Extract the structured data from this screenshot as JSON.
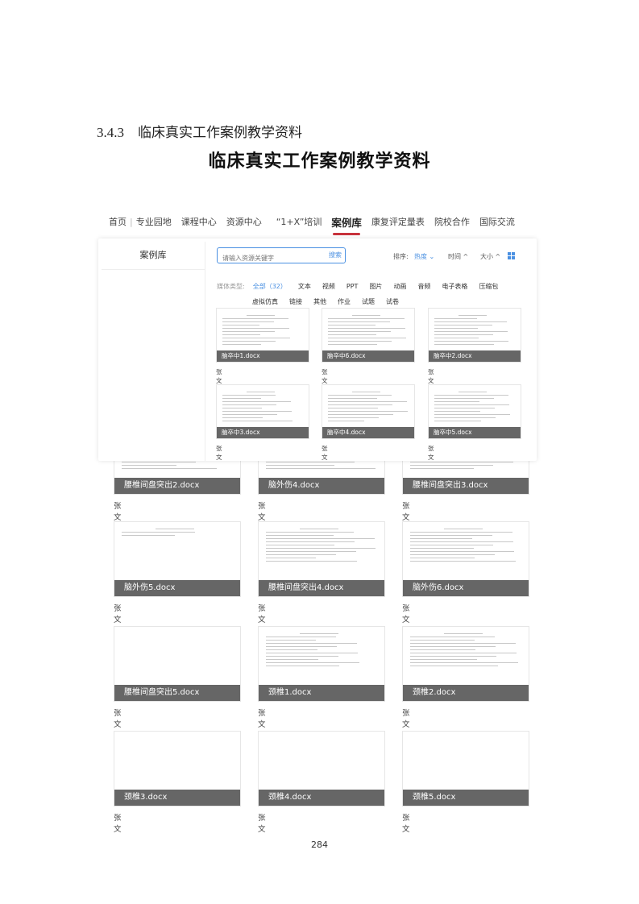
{
  "section": {
    "number": "3.4.3",
    "title": "临床真实工作案例教学资料"
  },
  "main_title": "临床真实工作案例教学资料",
  "nav": {
    "items": [
      "首页",
      "专业园地",
      "课程中心",
      "资源中心",
      "“1+X”培训",
      "案例库",
      "康复评定量表",
      "院校合作",
      "国际交流"
    ],
    "active": "案例库"
  },
  "sidebar": {
    "title": "案例库"
  },
  "search": {
    "placeholder": "请输入资源关键字",
    "button": "搜索"
  },
  "sort": {
    "label": "排序:",
    "hot": "热度",
    "time": "时间",
    "size": "大小"
  },
  "filters": {
    "label": "媒体类型:",
    "items": [
      "全部（32）",
      "文本",
      "视频",
      "PPT",
      "图片",
      "动画",
      "音频",
      "电子表格",
      "压缩包",
      "虚拟仿真",
      "链接",
      "其他",
      "作业",
      "试题",
      "试卷"
    ],
    "selected": "全部（32）"
  },
  "top_cards": [
    {
      "name": "脑卒中1.docx",
      "author": "张文"
    },
    {
      "name": "脑卒中6.docx",
      "author": "张文"
    },
    {
      "name": "脑卒中2.docx",
      "author": "张文"
    },
    {
      "name": "脑卒中3.docx",
      "author": "张文"
    },
    {
      "name": "脑卒中4.docx",
      "author": "张文"
    },
    {
      "name": "脑卒中5.docx",
      "author": "张文"
    }
  ],
  "cards": [
    {
      "name": "腰椎间盘突出2.docx",
      "author": "张文"
    },
    {
      "name": "脑外伤4.docx",
      "author": "张文"
    },
    {
      "name": "腰椎间盘突出3.docx",
      "author": "张文"
    },
    {
      "name": "脑外伤5.docx",
      "author": "张文"
    },
    {
      "name": "腰椎间盘突出4.docx",
      "author": "张文"
    },
    {
      "name": "脑外伤6.docx",
      "author": "张文"
    },
    {
      "name": "腰椎间盘突出5.docx",
      "author": "张文"
    },
    {
      "name": "颈椎1.docx",
      "author": "张文"
    },
    {
      "name": "颈椎2.docx",
      "author": "张文"
    },
    {
      "name": "颈椎3.docx",
      "author": "张文"
    },
    {
      "name": "颈椎4.docx",
      "author": "张文"
    },
    {
      "name": "颈椎5.docx",
      "author": "张文"
    }
  ],
  "page_number": "284"
}
